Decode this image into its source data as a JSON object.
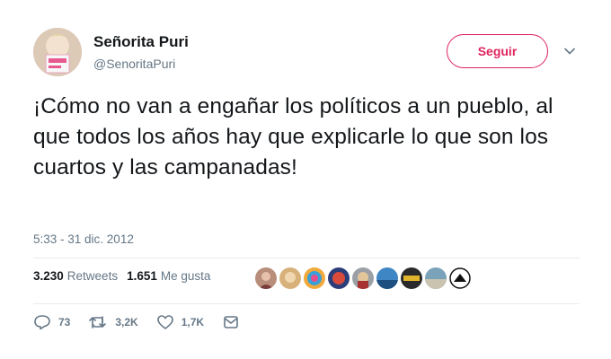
{
  "author": {
    "name": "Señorita Puri",
    "handle": "@SenoritaPuri"
  },
  "follow_button": "Seguir",
  "tweet_text": "¡Cómo no van a engañar los políticos a un pueblo, al que todos los años hay que explicarle lo que son los cuartos y las campanadas!",
  "timestamp": "5:33 - 31 dic. 2012",
  "stats": {
    "retweets_count": "3.230",
    "retweets_label": "Retweets",
    "likes_count": "1.651",
    "likes_label": "Me gusta"
  },
  "actions": {
    "replies": "73",
    "retweets": "3,2K",
    "likes": "1,7K"
  },
  "icons": [
    "caret-down-icon",
    "reply-icon",
    "retweet-icon",
    "heart-icon",
    "message-icon"
  ],
  "colors": {
    "accent": "#e0245e",
    "secondary_text": "#657786",
    "divider": "#e6ecf0"
  }
}
